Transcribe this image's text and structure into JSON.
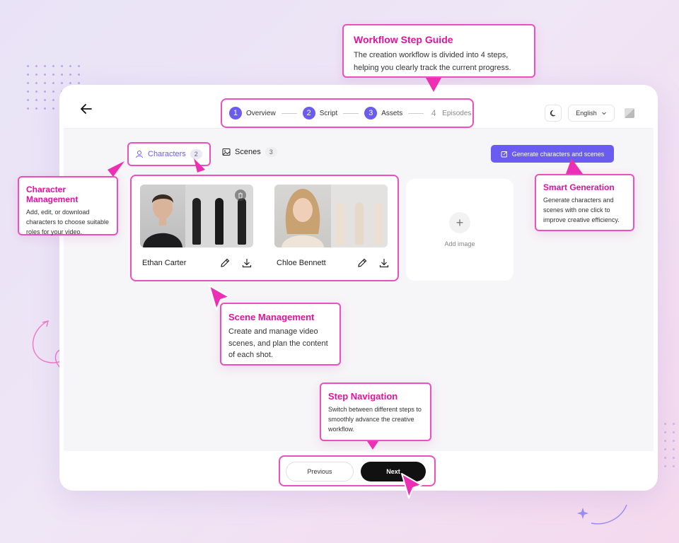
{
  "stepper": {
    "steps": [
      {
        "num": "1",
        "label": "Overview"
      },
      {
        "num": "2",
        "label": "Script"
      },
      {
        "num": "3",
        "label": "Assets"
      },
      {
        "num": "4",
        "label": "Episodes"
      }
    ]
  },
  "header": {
    "language": "English"
  },
  "tabs": {
    "characters": {
      "label": "Characters",
      "count": "2"
    },
    "scenes": {
      "label": "Scenes",
      "count": "3"
    }
  },
  "generate_button": "Generate characters and scenes",
  "characters": [
    {
      "name": "Ethan Carter"
    },
    {
      "name": "Chloe Bennett"
    }
  ],
  "add_image_label": "Add image",
  "nav": {
    "previous": "Previous",
    "next": "Next"
  },
  "callouts": {
    "workflow": {
      "title": "Workflow Step Guide",
      "text": "The creation workflow is divided into 4 steps, helping you clearly track the current progress."
    },
    "character": {
      "title": "Character Management",
      "text": "Add, edit, or download characters to choose suitable roles for your video."
    },
    "smart": {
      "title": "Smart Generation",
      "text": "Generate characters and scenes with one click to improve creative efficiency."
    },
    "scene": {
      "title": "Scene Management",
      "text": "Create and manage video scenes, and plan the content of each shot."
    },
    "step": {
      "title": "Step Navigation",
      "text": "Switch between different steps to smoothly advance the creative workflow."
    }
  },
  "colors": {
    "accent": "#6a5cf0",
    "highlight": "#ec4fbf",
    "callout_title": "#e0139e"
  }
}
